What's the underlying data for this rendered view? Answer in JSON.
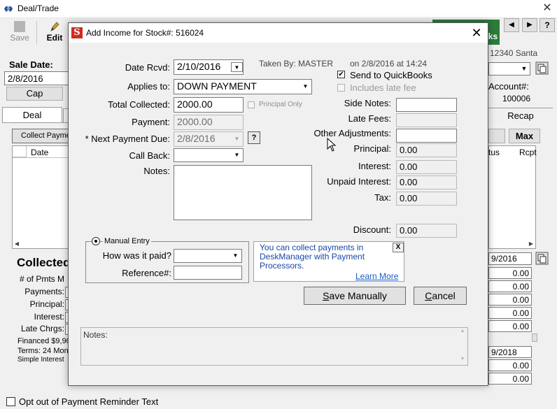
{
  "main_window": {
    "title": "Deal/Trade",
    "close_glyph": "✕",
    "toolbar": {
      "save_label": "Save",
      "edit_label": "Edit"
    },
    "qb_banner": "ks",
    "nav": {
      "prev": "◀",
      "next": "▶",
      "help": "?"
    },
    "sale_date_label": "Sale Date:",
    "sale_date_value": "2/8/2016",
    "cap_label": "Cap",
    "deal_tab": "Deal",
    "collect_payment_button": "Collect Payme",
    "grid_date_header": "Date",
    "collected_heading": "Collected",
    "labels": {
      "pmts": "# of Pmts M",
      "payments": "Payments:",
      "principal": "Principal:",
      "interest": "Interest:",
      "late_chrgs": "Late Chrgs:"
    },
    "financed": "Financed $9,90",
    "terms": "Terms: 24 Mon",
    "simple_interest": "Simple Interest",
    "opt_out_label": "Opt out of Payment Reminder Text",
    "right": {
      "address": "12340 Santa",
      "account_label": "Account#:",
      "account_value": "100006",
      "recap_tab": "Recap",
      "max_button": "Max",
      "status_header": "tus",
      "rcpt_header": "Rcpt",
      "date1": "9/2016",
      "values": [
        "0.00",
        "0.00",
        "0.00",
        "0.00",
        "0.00",
        "0.00",
        "0.00"
      ],
      "date2": "9/2018"
    }
  },
  "dialog": {
    "title": "Add Income for Stock#: 516024",
    "close_glyph": "✕",
    "icon_letter": "S",
    "date_rcvd_label": "Date Rcvd:",
    "date_rcvd_value": "2/10/2016",
    "applies_to_label": "Applies to:",
    "applies_to_value": "DOWN PAYMENT",
    "total_collected_label": "Total Collected:",
    "total_collected_value": "2000.00",
    "principal_only_label": "Principal Only",
    "payment_label": "Payment:",
    "payment_value": "2000.00",
    "next_payment_label": "* Next Payment Due:",
    "next_payment_value": "2/8/2016",
    "help_glyph": "?",
    "call_back_label": "Call Back:",
    "notes_label": "Notes:",
    "taken_by": "Taken By:  MASTER",
    "taken_on": "on 2/8/2016 at 14:24",
    "send_qb_label": "Send to QuickBooks",
    "send_qb_checked": true,
    "late_fee_label": "Includes late fee",
    "side_notes_label": "Side Notes:",
    "late_fees_label": "Late Fees:",
    "other_adj_label": "Other Adjustments:",
    "principal_label": "Principal:",
    "principal_value": "0.00",
    "interest_label": "Interest:",
    "interest_value": "0.00",
    "unpaid_interest_label": "Unpaid Interest:",
    "unpaid_interest_value": "0.00",
    "tax_label": "Tax:",
    "tax_value": "0.00",
    "discount_label": "Discount:",
    "discount_value": "0.00",
    "manual_entry_label": "Manual Entry",
    "how_paid_label": "How was it paid?",
    "reference_label": "Reference#:",
    "info_text": "You can collect payments in DeskManager with Payment Processors.",
    "info_close": "X",
    "learn_more": "Learn More",
    "save_manually": {
      "first": "S",
      "rest": "ave Manually"
    },
    "cancel": {
      "first": "C",
      "rest": "ancel"
    },
    "bottom_notes_label": "Notes:"
  },
  "colors": {
    "qb_green": "#2c7c3b",
    "dialog_icon_red": "#d02b1f",
    "info_text_blue": "#1847a6",
    "link_blue": "#1c5fc9"
  },
  "icons": [
    "deal-app-icon",
    "save-icon",
    "edit-icon",
    "copy-icon",
    "dropdown-arrow-icon",
    "help-icon",
    "mouse-cursor-icon",
    "checkmark-icon",
    "radio-selected-icon"
  ]
}
